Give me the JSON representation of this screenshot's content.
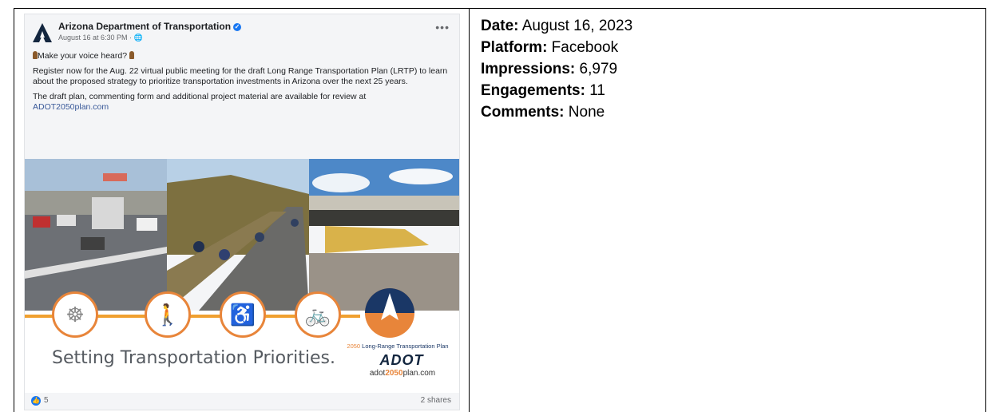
{
  "post": {
    "page_name": "Arizona Department of Transportation",
    "meta": "August 16 at 6:30 PM · ",
    "tagline": "Make your voice heard?",
    "body_1": "Register now for the Aug. 22 virtual public meeting for the draft Long Range Transportation Plan (LRTP)  to learn about the proposed strategy to prioritize transportation investments in Arizona over the next 25 years.",
    "body_2": "The draft plan, commenting form and additional project material are available for review at",
    "link": "ADOT2050plan.com",
    "banner_title": "Setting Transportation Priorities.",
    "plan_label_year": "2050",
    "plan_label_rest": " Long-Range Transportation Plan",
    "adot_logo": "ADOT",
    "url_prefix": "adot",
    "url_year": "2050",
    "url_suffix": "plan.com",
    "likes": "5",
    "shares": "2 shares"
  },
  "stats": {
    "date_label": "Date:",
    "date_value": " August 16, 2023",
    "platform_label": "Platform:",
    "platform_value": " Facebook",
    "impressions_label": "Impressions:",
    "impressions_value": " 6,979",
    "engagements_label": "Engagements:",
    "engagements_value": " 11",
    "comments_label": "Comments:",
    "comments_value": " None"
  },
  "colors": {
    "accent_orange": "#e8853a",
    "facebook_blue": "#1877f2",
    "adot_navy": "#13263f"
  },
  "icons": [
    "adot-logo-icon",
    "verified-icon",
    "globe-icon",
    "more-icon",
    "microphone-icon",
    "steering-wheel-icon",
    "pedestrian-icon",
    "accessibility-icon",
    "bicycle-icon",
    "like-icon"
  ]
}
